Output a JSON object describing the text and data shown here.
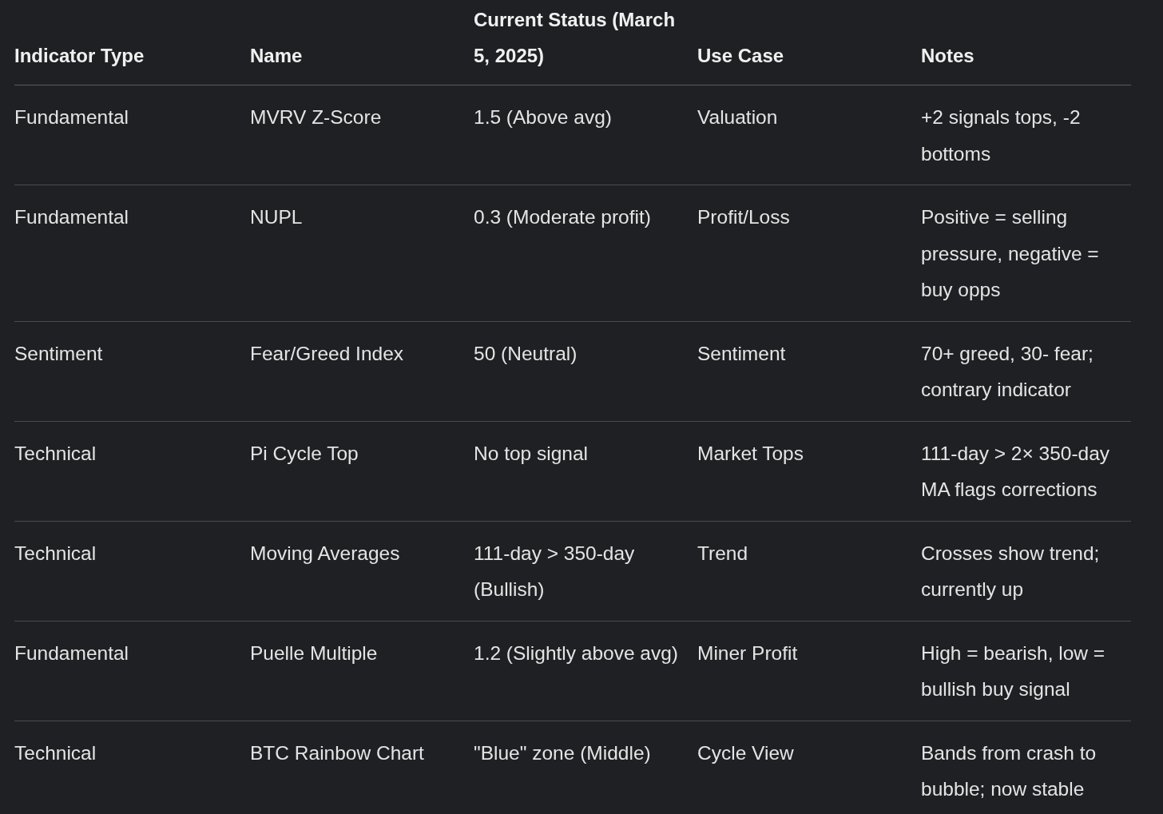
{
  "table": {
    "columns": [
      "Indicator Type",
      "Name",
      "Current Status (March 5, 2025)",
      "Use Case",
      "Notes"
    ],
    "rows": [
      [
        "Fundamental",
        "MVRV Z-Score",
        "1.5 (Above avg)",
        "Valuation",
        "+2 signals tops, -2 bottoms"
      ],
      [
        "Fundamental",
        "NUPL",
        "0.3 (Moderate profit)",
        "Profit/Loss",
        "Positive = selling pressure, negative = buy opps"
      ],
      [
        "Sentiment",
        "Fear/Greed Index",
        "50 (Neutral)",
        "Sentiment",
        "70+ greed, 30- fear; contrary indicator"
      ],
      [
        "Technical",
        "Pi Cycle Top",
        "No top signal",
        "Market Tops",
        "111-day > 2× 350-day MA flags corrections"
      ],
      [
        "Technical",
        "Moving Averages",
        "111-day > 350-day (Bullish)",
        "Trend",
        "Crosses show trend; currently up"
      ],
      [
        "Fundamental",
        "Puelle Multiple",
        "1.2 (Slightly above avg)",
        "Miner Profit",
        "High = bearish, low = bullish buy signal"
      ],
      [
        "Technical",
        "BTC Rainbow Chart",
        "\"Blue\" zone (Middle)",
        "Cycle View",
        "Bands from crash to bubble; now stable"
      ]
    ]
  }
}
